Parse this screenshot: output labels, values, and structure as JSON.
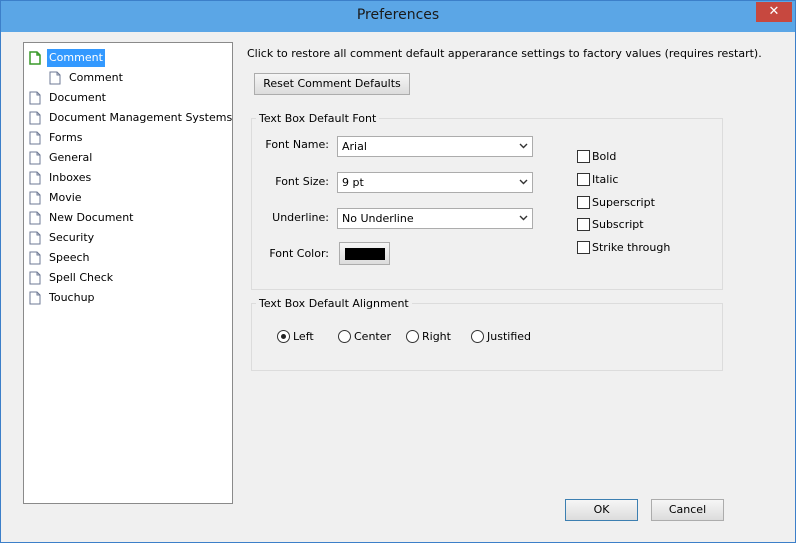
{
  "window": {
    "title": "Preferences",
    "close_glyph": "✕"
  },
  "tree": {
    "items": [
      {
        "label": "Comment",
        "selected": true,
        "indent": 0,
        "icon": "doc-green-icon"
      },
      {
        "label": "Comment",
        "selected": false,
        "indent": 1,
        "icon": "doc-icon"
      },
      {
        "label": "Document",
        "selected": false,
        "indent": 0,
        "icon": "doc-icon"
      },
      {
        "label": "Document Management Systems",
        "selected": false,
        "indent": 0,
        "icon": "doc-icon"
      },
      {
        "label": "Forms",
        "selected": false,
        "indent": 0,
        "icon": "doc-icon"
      },
      {
        "label": "General",
        "selected": false,
        "indent": 0,
        "icon": "doc-icon"
      },
      {
        "label": "Inboxes",
        "selected": false,
        "indent": 0,
        "icon": "doc-icon"
      },
      {
        "label": "Movie",
        "selected": false,
        "indent": 0,
        "icon": "doc-icon"
      },
      {
        "label": "New Document",
        "selected": false,
        "indent": 0,
        "icon": "doc-icon"
      },
      {
        "label": "Security",
        "selected": false,
        "indent": 0,
        "icon": "doc-icon"
      },
      {
        "label": "Speech",
        "selected": false,
        "indent": 0,
        "icon": "doc-icon"
      },
      {
        "label": "Spell Check",
        "selected": false,
        "indent": 0,
        "icon": "doc-icon"
      },
      {
        "label": "Touchup",
        "selected": false,
        "indent": 0,
        "icon": "doc-icon"
      }
    ]
  },
  "main": {
    "description": "Click to restore all comment default apperarance settings to factory values (requires restart).",
    "reset_button": "Reset Comment Defaults",
    "font_group": {
      "title": "Text Box Default Font",
      "font_name_label": "Font Name:",
      "font_name_value": "Arial",
      "font_size_label": "Font Size:",
      "font_size_value": "9 pt",
      "underline_label": "Underline:",
      "underline_value": "No Underline",
      "font_color_label": "Font Color:",
      "font_color_value": "#000000",
      "checkboxes": [
        {
          "label": "Bold",
          "checked": false
        },
        {
          "label": "Italic",
          "checked": false
        },
        {
          "label": "Superscript",
          "checked": false
        },
        {
          "label": "Subscript",
          "checked": false
        },
        {
          "label": "Strike through",
          "checked": false
        }
      ]
    },
    "align_group": {
      "title": "Text Box Default Alignment",
      "options": [
        {
          "label": "Left",
          "selected": true
        },
        {
          "label": "Center",
          "selected": false
        },
        {
          "label": "Right",
          "selected": false
        },
        {
          "label": "Justified",
          "selected": false
        }
      ]
    }
  },
  "footer": {
    "ok_label": "OK",
    "cancel_label": "Cancel"
  }
}
